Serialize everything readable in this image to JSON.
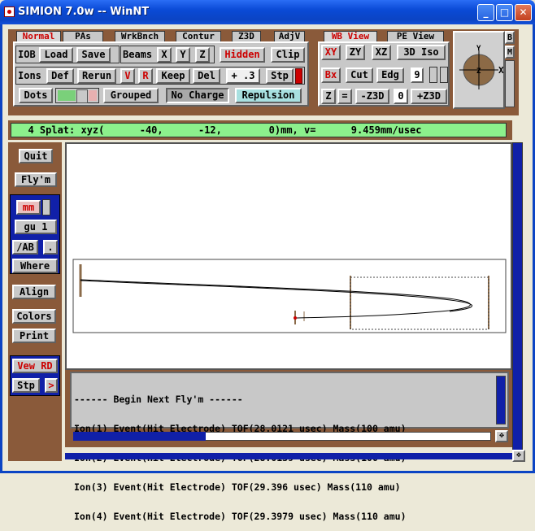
{
  "window": {
    "title": "SIMION 7.0w -- WinNT",
    "min": "_",
    "max": "□",
    "close": "✕"
  },
  "tabs_left": [
    "Normal",
    "PAs",
    "WrkBnch",
    "Contur",
    "Z3D",
    "AdjV"
  ],
  "tabs_right": [
    "WB View",
    "PE View"
  ],
  "toolbar": {
    "iob_label": "IOB",
    "load": "Load",
    "save": "Save",
    "beams_label": "Beams",
    "x": "X",
    "y": "Y",
    "z": "Z",
    "hidden": "Hidden",
    "clip": "Clip",
    "ions_label": "Ions",
    "def": "Def",
    "rerun": "Rerun",
    "v": "V",
    "r": "R",
    "keep": "Keep",
    "del": "Del",
    "step_value": "+ .3",
    "stp": "Stp",
    "dots": "Dots",
    "grouped": "Grouped",
    "no_charge": "No Charge",
    "repulsion": "Repulsion"
  },
  "view_controls": {
    "xy": "XY",
    "zy": "ZY",
    "xz": "XZ",
    "iso": "3D Iso",
    "bx": "Bx",
    "cut": "Cut",
    "edg": "Edg",
    "num": "9",
    "z": "Z",
    "eq": "=",
    "minus_z3d": "-Z3D",
    "zero": "0",
    "plus_z3d": "+Z3D",
    "side_b": "B",
    "side_m": "M",
    "compass_center": "Z",
    "compass_y": "Y",
    "compass_x": "X"
  },
  "status": "  4 Splat: xyz(      -40,      -12,        0)mm, v=      9.459mm/usec",
  "left_panel": {
    "quit": "Quit",
    "flym": "Fly'm",
    "mm": "mm",
    "gu": "gu  1",
    "ab": "/AB",
    "dot": ".",
    "where": "Where",
    "align": "Align",
    "colors": "Colors",
    "print": "Print",
    "view_rd": "Vew RD",
    "stp": "Stp",
    "arrow": ">"
  },
  "log_lines": [
    "------ Begin Next Fly'm ------",
    "Ion(1) Event(Hit Electrode) TOF(28.0121 usec) Mass(100 amu)",
    "Ion(2) Event(Hit Electrode) TOF(28.0139 usec) Mass(100 amu)",
    "Ion(3) Event(Hit Electrode) TOF(29.396 usec) Mass(110 amu)",
    "Ion(4) Event(Hit Electrode) TOF(29.3979 usec) Mass(110 amu)"
  ],
  "colors": {
    "title_blue": "#0b44c4",
    "status_green": "#8cf08c",
    "panel_brown": "#8a5a3a",
    "scroll_blue": "#1020a8",
    "accent_red": "#c00000"
  }
}
